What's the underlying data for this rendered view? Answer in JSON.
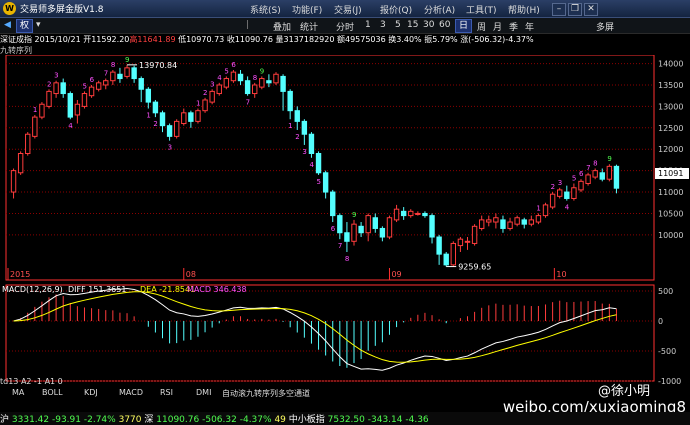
{
  "window": {
    "title": "交易师多屏金版V1.8",
    "menus": [
      "系统(S)",
      "功能(F)",
      "交易(J)",
      "报价(Q)",
      "分析(A)",
      "工具(T)",
      "帮助(H)"
    ],
    "right_label": "多屏"
  },
  "toolbar": {
    "selected": "权",
    "items": [
      "叠加",
      "统计",
      "分时",
      "1",
      "3",
      "5",
      "15",
      "30",
      "60",
      "日",
      "周",
      "月",
      "季",
      "年"
    ]
  },
  "info_bar": {
    "name": "深证成指",
    "date": "2015/10/21",
    "open": "开11592.20",
    "high": "高11641.89",
    "low": "低10970.73",
    "close": "收11090.76",
    "volume": "量3137182920",
    "amount": "额49575036",
    "turnover": "换3.40%",
    "amplitude": "振5.79%",
    "change": "涨(-506.32)-4.37%"
  },
  "overlay_label": "九转序列",
  "colors": {
    "up": "#ff3c3c",
    "down": "#54ffff",
    "grid": "#8b0000",
    "axis": "#ff3030",
    "magenta": "#ff50ff",
    "green": "#50ff50",
    "yellow": "#ffff00"
  },
  "chart_data": {
    "type": "candlestick",
    "ylim": [
      9250,
      14200
    ],
    "y_ticks": [
      "14000",
      "13500",
      "13000",
      "12500",
      "12000",
      "11500",
      "11000",
      "10500",
      "10000"
    ],
    "period_labels": [
      "2015",
      "08",
      "09",
      "10"
    ],
    "last_price_label": "11091",
    "high_marker": "13970.84",
    "low_marker": "9259.65",
    "candles": [
      [
        11000,
        11500,
        10850,
        11550
      ],
      [
        11450,
        11900,
        11400,
        11950
      ],
      [
        11900,
        12350,
        11850,
        12400
      ],
      [
        12300,
        12750,
        12250,
        12800
      ],
      [
        12750,
        13050,
        12700,
        13100
      ],
      [
        13000,
        13350,
        12950,
        13400
      ],
      [
        13300,
        13550,
        13200,
        13600
      ],
      [
        13550,
        13300,
        13200,
        13650
      ],
      [
        13300,
        12750,
        12700,
        13350
      ],
      [
        12800,
        13050,
        12600,
        13150
      ],
      [
        13000,
        13300,
        12950,
        13350
      ],
      [
        13250,
        13450,
        13200,
        13500
      ],
      [
        13400,
        13550,
        13350,
        13600
      ],
      [
        13500,
        13600,
        13400,
        13650
      ],
      [
        13600,
        13800,
        13500,
        13850
      ],
      [
        13750,
        13650,
        13550,
        13900
      ],
      [
        13700,
        13900,
        13650,
        13970
      ],
      [
        13900,
        13650,
        13550,
        13950
      ],
      [
        13650,
        13400,
        13100,
        13700
      ],
      [
        13400,
        13100,
        12950,
        13450
      ],
      [
        13100,
        12850,
        12750,
        13150
      ],
      [
        12850,
        12550,
        12400,
        12900
      ],
      [
        12550,
        12300,
        12200,
        12600
      ],
      [
        12300,
        12650,
        12250,
        12700
      ],
      [
        12600,
        12850,
        12550,
        12950
      ],
      [
        12850,
        12650,
        12500,
        12900
      ],
      [
        12650,
        12900,
        12600,
        12950
      ],
      [
        12900,
        13150,
        12850,
        13200
      ],
      [
        13100,
        13350,
        13050,
        13400
      ],
      [
        13300,
        13500,
        13250,
        13550
      ],
      [
        13450,
        13650,
        13400,
        13700
      ],
      [
        13600,
        13800,
        13550,
        13850
      ],
      [
        13750,
        13600,
        13500,
        13850
      ],
      [
        13600,
        13300,
        13250,
        13700
      ],
      [
        13300,
        13500,
        13200,
        13550
      ],
      [
        13450,
        13650,
        13400,
        13700
      ],
      [
        13600,
        13550,
        13450,
        13750
      ],
      [
        13550,
        13750,
        13500,
        13800
      ],
      [
        13700,
        13350,
        12900,
        13750
      ],
      [
        13350,
        12900,
        12700,
        13400
      ],
      [
        12900,
        12650,
        12450,
        13000
      ],
      [
        12650,
        12350,
        12100,
        12700
      ],
      [
        12350,
        11900,
        11800,
        12400
      ],
      [
        11900,
        11450,
        11400,
        11950
      ],
      [
        11450,
        11000,
        10850,
        11500
      ],
      [
        11000,
        10450,
        10300,
        11050
      ],
      [
        10450,
        10050,
        9900,
        10500
      ],
      [
        10050,
        9850,
        9600,
        10300
      ],
      [
        9850,
        10250,
        9750,
        10350
      ],
      [
        10200,
        10050,
        9950,
        10300
      ],
      [
        10050,
        10450,
        9850,
        10500
      ],
      [
        10400,
        10150,
        10050,
        10500
      ],
      [
        10150,
        9950,
        9850,
        10200
      ],
      [
        9950,
        10400,
        9900,
        10450
      ],
      [
        10350,
        10600,
        10300,
        10700
      ],
      [
        10550,
        10450,
        10350,
        10650
      ],
      [
        10450,
        10550,
        10400,
        10600
      ],
      [
        10500,
        10500,
        10450,
        10550
      ],
      [
        10500,
        10450,
        10400,
        10550
      ],
      [
        10450,
        9950,
        9800,
        10500
      ],
      [
        9950,
        9550,
        9300,
        10000
      ],
      [
        9550,
        9300,
        9260,
        9600
      ],
      [
        9300,
        9800,
        9260,
        9850
      ],
      [
        9750,
        9900,
        9600,
        9950
      ],
      [
        9850,
        9850,
        9650,
        9950
      ],
      [
        9800,
        10200,
        9750,
        10250
      ],
      [
        10150,
        10350,
        10100,
        10450
      ],
      [
        10300,
        10350,
        10200,
        10450
      ],
      [
        10300,
        10400,
        10150,
        10500
      ],
      [
        10350,
        10150,
        10050,
        10450
      ],
      [
        10150,
        10300,
        10100,
        10400
      ],
      [
        10250,
        10400,
        10200,
        10450
      ],
      [
        10350,
        10250,
        10150,
        10400
      ],
      [
        10250,
        10350,
        10200,
        10450
      ],
      [
        10300,
        10450,
        10250,
        10500
      ],
      [
        10450,
        10700,
        10400,
        10750
      ],
      [
        10650,
        10950,
        10600,
        11000
      ],
      [
        10900,
        11050,
        10850,
        11100
      ],
      [
        11000,
        10850,
        10800,
        11150
      ],
      [
        10850,
        11100,
        10800,
        11200
      ],
      [
        11050,
        11250,
        11000,
        11300
      ],
      [
        11200,
        11400,
        11150,
        11450
      ],
      [
        11350,
        11500,
        11300,
        11550
      ],
      [
        11450,
        11300,
        11250,
        11550
      ],
      [
        11300,
        11600,
        11250,
        11650
      ],
      [
        11600,
        11090,
        10970,
        11640
      ]
    ],
    "nine_count": [
      {
        "i": 3,
        "n": "1"
      },
      {
        "i": 5,
        "n": "2"
      },
      {
        "i": 6,
        "n": "3"
      },
      {
        "i": 8,
        "n": "4"
      },
      {
        "i": 10,
        "n": "5"
      },
      {
        "i": 11,
        "n": "6"
      },
      {
        "i": 13,
        "n": "7"
      },
      {
        "i": 14,
        "n": "8"
      },
      {
        "i": 16,
        "n": "9"
      },
      {
        "i": 19,
        "n": "1"
      },
      {
        "i": 20,
        "n": "2"
      },
      {
        "i": 22,
        "n": "3"
      },
      {
        "i": 26,
        "n": "1"
      },
      {
        "i": 27,
        "n": "2"
      },
      {
        "i": 28,
        "n": "3"
      },
      {
        "i": 29,
        "n": "4"
      },
      {
        "i": 30,
        "n": "5"
      },
      {
        "i": 31,
        "n": "6"
      },
      {
        "i": 33,
        "n": "7"
      },
      {
        "i": 34,
        "n": "8"
      },
      {
        "i": 35,
        "n": "9"
      },
      {
        "i": 39,
        "n": "1"
      },
      {
        "i": 40,
        "n": "2"
      },
      {
        "i": 41,
        "n": "3"
      },
      {
        "i": 42,
        "n": "4"
      },
      {
        "i": 43,
        "n": "5"
      },
      {
        "i": 45,
        "n": "6"
      },
      {
        "i": 46,
        "n": "7"
      },
      {
        "i": 47,
        "n": "8"
      },
      {
        "i": 48,
        "n": "9"
      },
      {
        "i": 74,
        "n": "1"
      },
      {
        "i": 76,
        "n": "2"
      },
      {
        "i": 77,
        "n": "3"
      },
      {
        "i": 78,
        "n": "4"
      },
      {
        "i": 79,
        "n": "5"
      },
      {
        "i": 80,
        "n": "6"
      },
      {
        "i": 81,
        "n": "7"
      },
      {
        "i": 82,
        "n": "8"
      },
      {
        "i": 84,
        "n": "9"
      }
    ],
    "macd": {
      "label": "MACD(12,26,9)",
      "diff": "DIFF 151.3651",
      "dea": "DEA -21.8541",
      "macd": "MACD 346.438",
      "ylim": [
        -1000,
        600
      ],
      "y_ticks": [
        "500",
        "0",
        "-500",
        "-1000"
      ]
    }
  },
  "bottom_tabs": [
    "MA",
    "BOLL",
    "KDJ",
    "MACD",
    "RSI",
    "DMI",
    "自动滚九转序列多空通道"
  ],
  "indicator_caption": "td13 A2 -1 A1 0",
  "status": {
    "sh_name": "沪",
    "sh_value": "3331.42",
    "sh_change": "-93.91",
    "sh_pct": "-2.74%",
    "sh_vol": "3770",
    "sz_name": "深",
    "sz_value": "11090.76",
    "sz_change": "-506.32",
    "sz_pct": "-4.37%",
    "sz_vol": "49",
    "zx_name": "中小板指",
    "zx_value": "7532.50",
    "zx_change": "-343.14",
    "zx_pct": "-4.36"
  },
  "watermark": {
    "name": "@徐小明",
    "url": "weibo.com/xuxiaoming8"
  }
}
